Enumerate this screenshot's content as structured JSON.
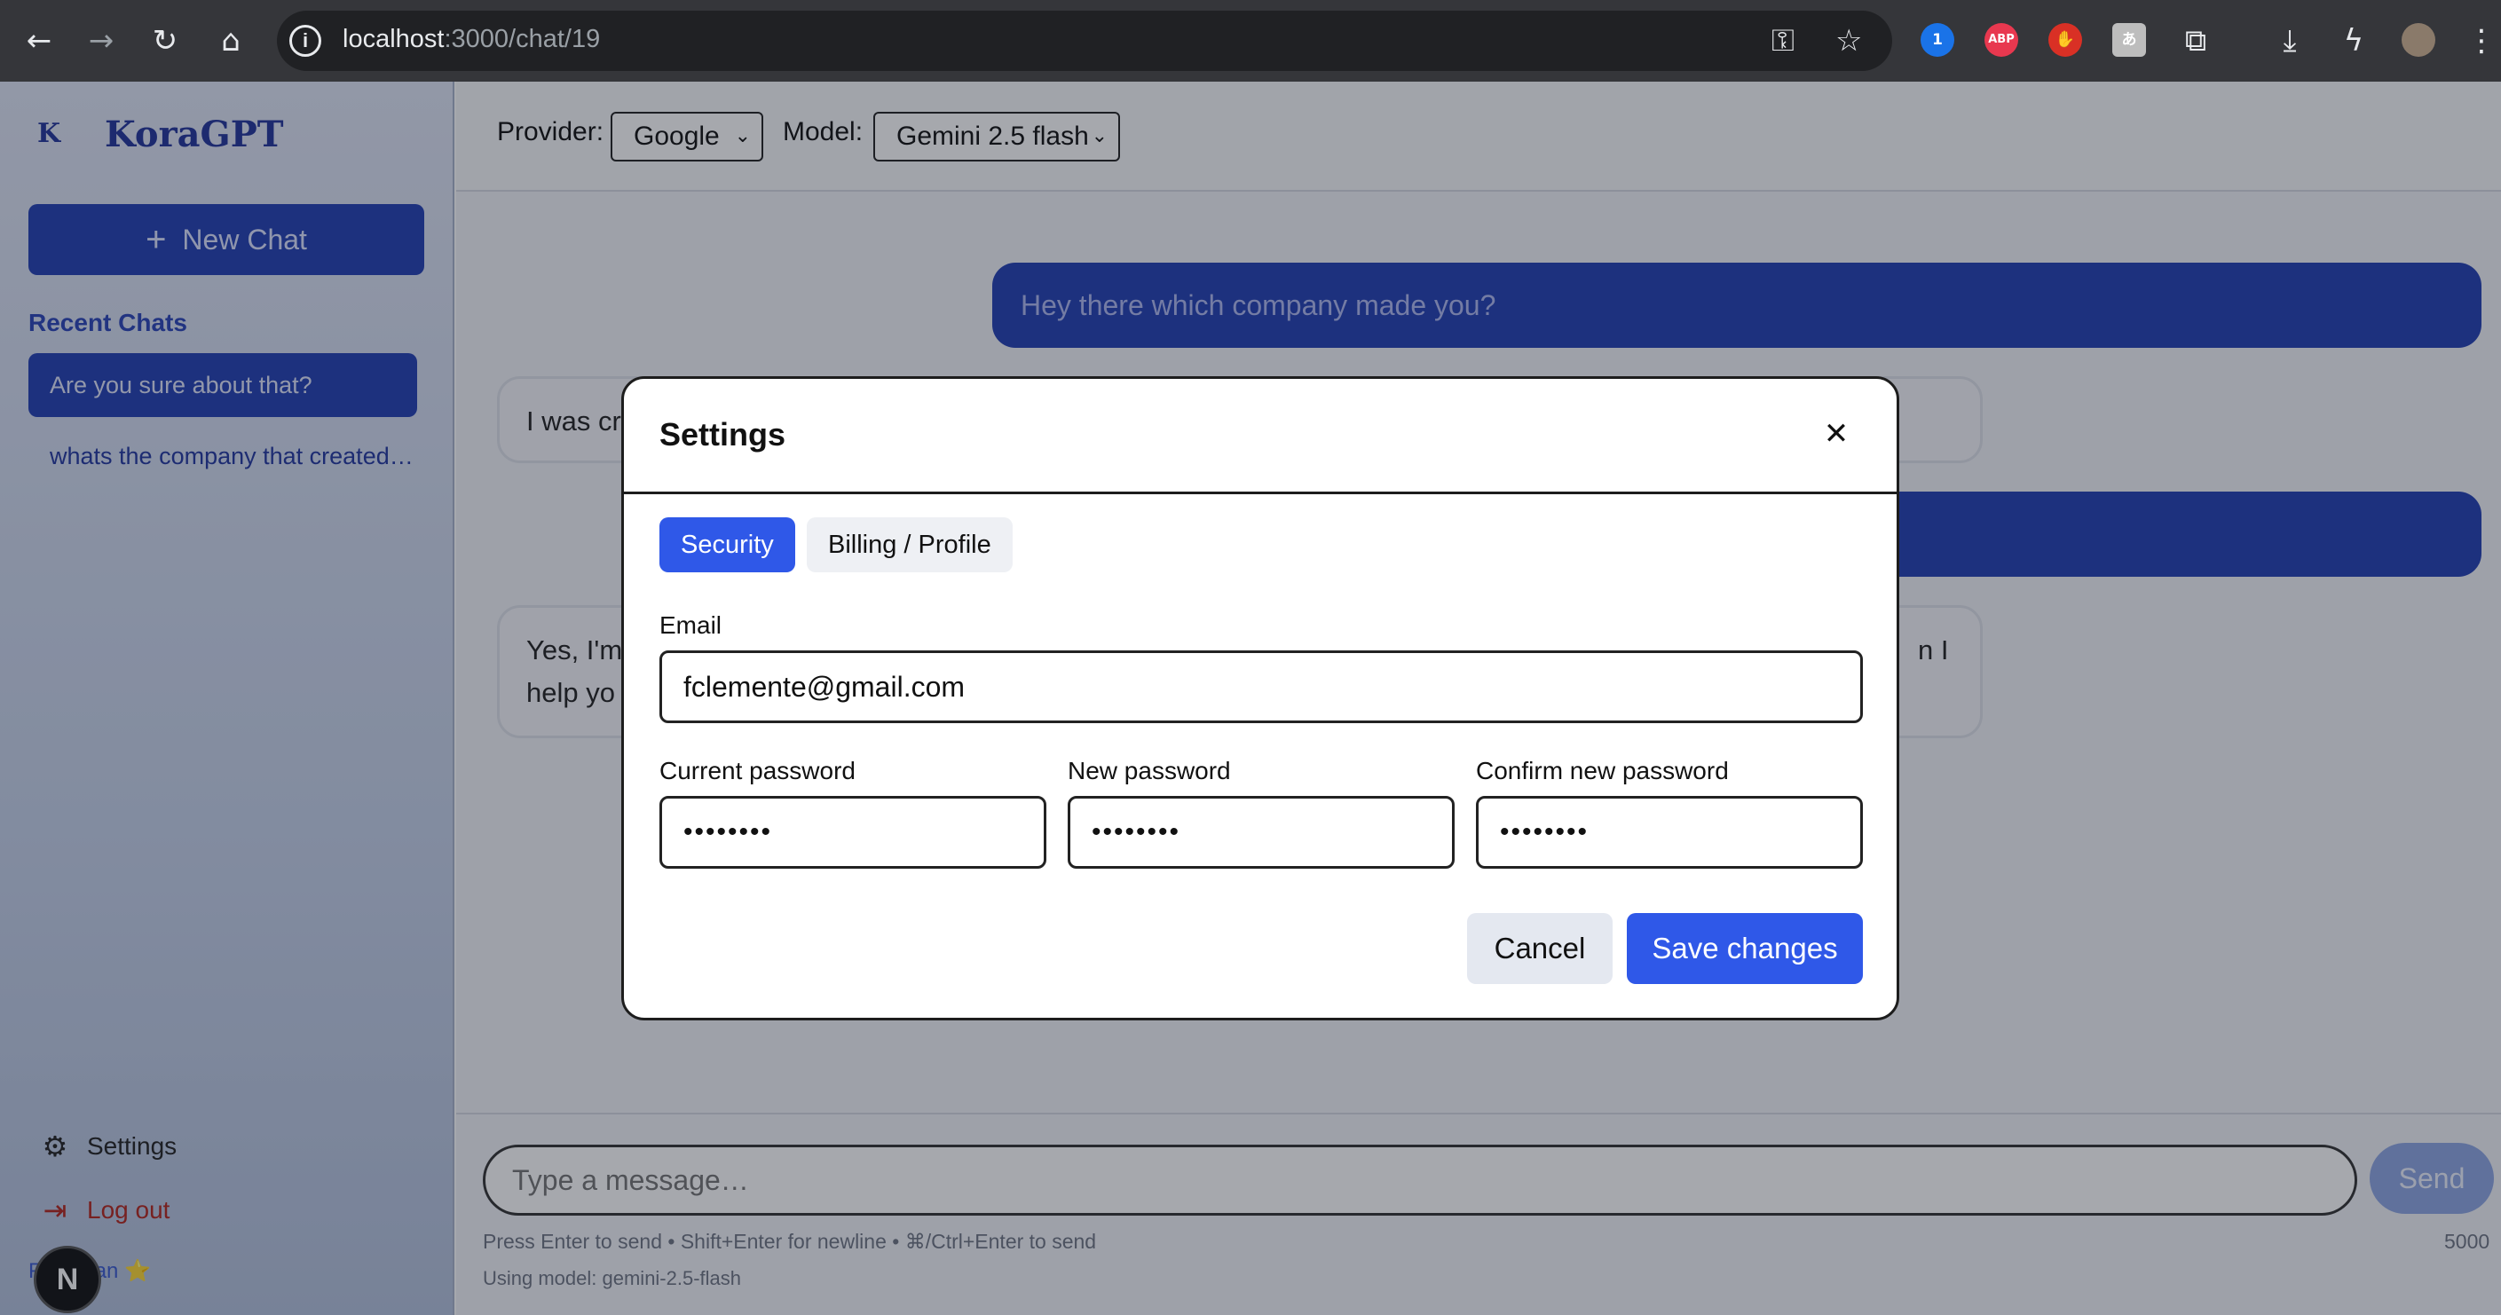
{
  "browser": {
    "url_host": "localhost",
    "url_path": ":3000/chat/19",
    "extensions": [
      {
        "name": "onepassword-icon",
        "glyph": "1",
        "color": "#1a73e8"
      },
      {
        "name": "adblock-icon",
        "glyph": "ABP",
        "color": "#e8384f"
      },
      {
        "name": "ublock-icon",
        "glyph": "✋",
        "color": "#d93025"
      },
      {
        "name": "translate-icon",
        "glyph": "あ",
        "color": "#bdbdbd"
      }
    ]
  },
  "sidebar": {
    "logo_letter": "K",
    "brand": "KoraGPT",
    "new_chat": "New Chat",
    "recent_title": "Recent Chats",
    "recent": [
      {
        "label": "Are you sure about that?",
        "active": true
      },
      {
        "label": "whats the company that created you?",
        "active": false
      }
    ],
    "settings": "Settings",
    "logout": "Log out",
    "plan": "Free plan ⭐",
    "badge": "N"
  },
  "topbar": {
    "provider_label": "Provider:",
    "provider_value": "Google",
    "model_label": "Model:",
    "model_value": "Gemini 2.5 flash"
  },
  "messages": [
    {
      "role": "user",
      "text": "Hey there which company made you?"
    },
    {
      "role": "assistant",
      "text": "I was cr"
    },
    {
      "role": "user",
      "text": ""
    },
    {
      "role": "assistant",
      "line1": "Yes, I'm",
      "line1_end": "n I",
      "line2": "help yo"
    }
  ],
  "composer": {
    "placeholder": "Type a message…",
    "send": "Send",
    "hint": "Press Enter to send • Shift+Enter for newline • ⌘/Ctrl+Enter to send",
    "model_hint": "Using model: gemini-2.5-flash",
    "count": "5000"
  },
  "modal": {
    "title": "Settings",
    "tabs": [
      "Security",
      "Billing / Profile"
    ],
    "email_label": "Email",
    "email_value": "fclemente@gmail.com",
    "current_pw_label": "Current password",
    "new_pw_label": "New password",
    "confirm_pw_label": "Confirm new password",
    "pw_mask": "••••••••",
    "cancel": "Cancel",
    "save": "Save changes"
  }
}
